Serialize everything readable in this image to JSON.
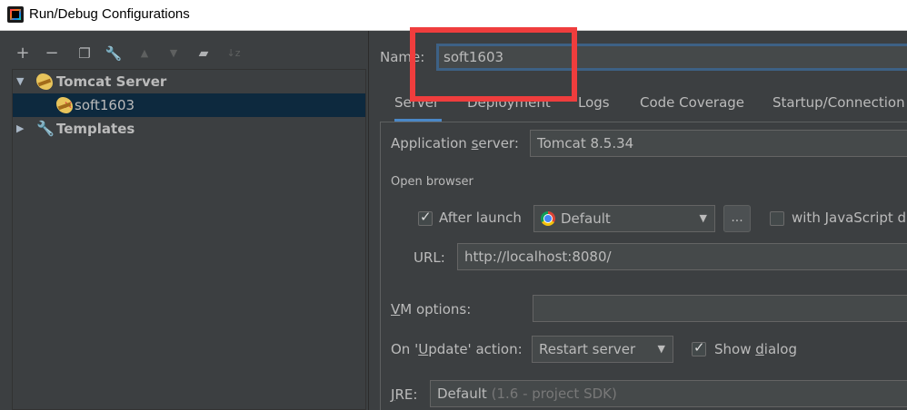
{
  "window": {
    "title": "Run/Debug Configurations"
  },
  "toolbar": {
    "add": "+",
    "remove": "−",
    "copy": "❐",
    "edit": "🔧",
    "up": "▲",
    "down": "▼",
    "folder": "▰",
    "sort": "↓z"
  },
  "tree": {
    "group_label": "Tomcat Server",
    "item_label": "soft1603",
    "templates_label": "Templates"
  },
  "name_field": {
    "label": "Name:",
    "value": "soft1603"
  },
  "tabs": [
    "Server",
    "Deployment",
    "Logs",
    "Code Coverage",
    "Startup/Connection"
  ],
  "server": {
    "app_server_label": "Application server:",
    "app_server_value": "Tomcat 8.5.34",
    "open_browser_label": "Open browser",
    "after_launch_label": "After launch",
    "after_launch_checked": true,
    "browser_value": "Default",
    "more_button": "...",
    "with_js_label": "with JavaScript de",
    "url_label": "URL:",
    "url_value": "http://localhost:8080/",
    "vm_options_label": "VM options:",
    "vm_options_value": "",
    "on_update_label": "On 'Update' action:",
    "on_update_value": "Restart server",
    "show_dialog_label": "Show dialog",
    "show_dialog_checked": true,
    "jre_label": "JRE:",
    "jre_value": "Default",
    "jre_hint": "(1.6 - project SDK)"
  },
  "colors": {
    "background": "#3c3f41",
    "selection": "#0d293e",
    "accent": "#4a88c7",
    "highlight_box": "#ef3d3d"
  }
}
